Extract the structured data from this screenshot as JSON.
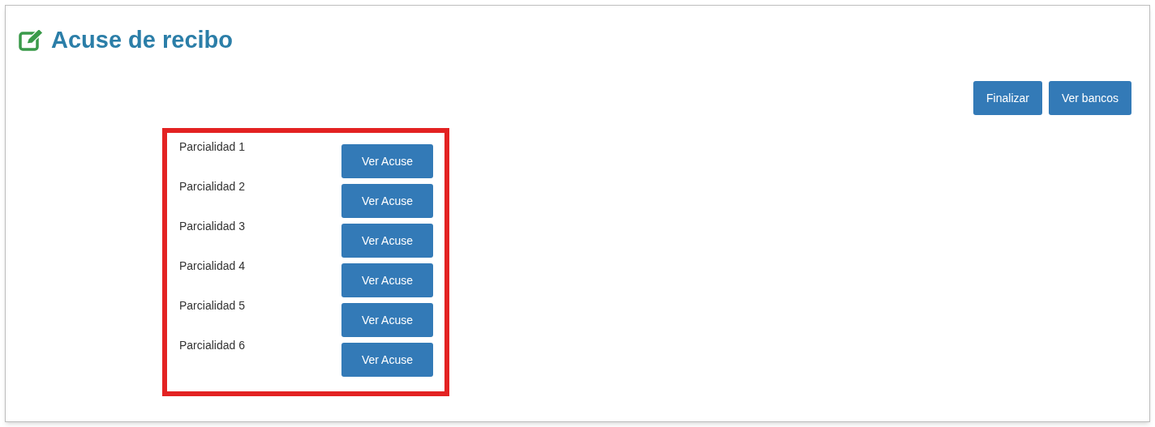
{
  "title": "Acuse de recibo",
  "actions": [
    "Finalizar",
    "Ver bancos"
  ],
  "rows": [
    {
      "label": "Parcialidad 1",
      "button": "Ver Acuse"
    },
    {
      "label": "Parcialidad 2",
      "button": "Ver Acuse"
    },
    {
      "label": "Parcialidad 3",
      "button": "Ver Acuse"
    },
    {
      "label": "Parcialidad 4",
      "button": "Ver Acuse"
    },
    {
      "label": "Parcialidad 5",
      "button": "Ver Acuse"
    },
    {
      "label": "Parcialidad 6",
      "button": "Ver Acuse"
    }
  ]
}
